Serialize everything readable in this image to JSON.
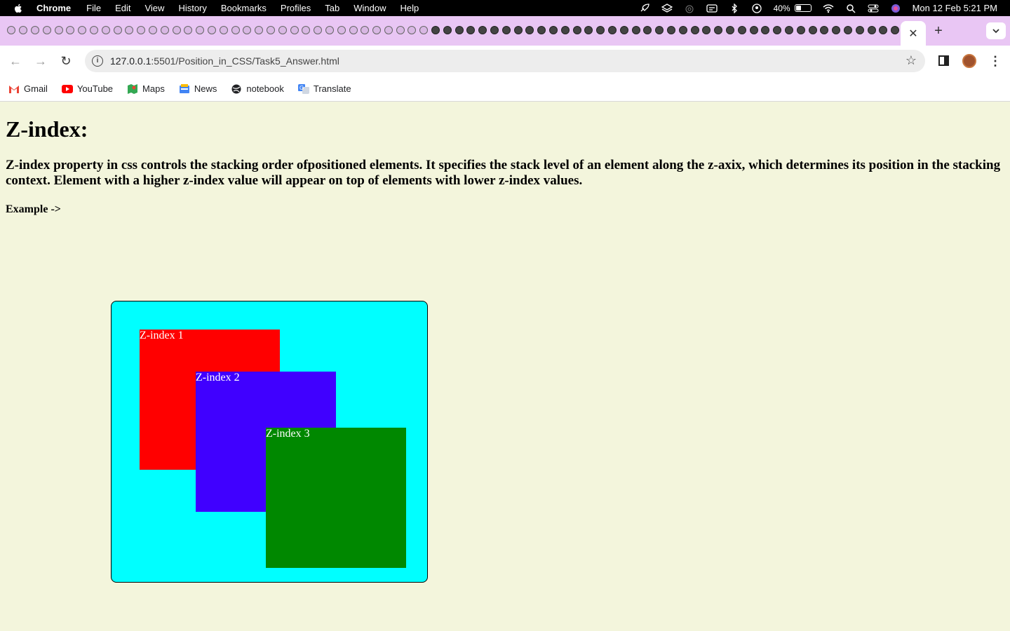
{
  "menubar": {
    "app_name": "Chrome",
    "menus": [
      "File",
      "Edit",
      "View",
      "History",
      "Bookmarks",
      "Profiles",
      "Tab",
      "Window",
      "Help"
    ],
    "battery_percent": "40%",
    "battery_level": 0.4,
    "datetime": "Mon 12 Feb  5:21 PM"
  },
  "tabs": {
    "favicon_count": 76,
    "close_glyph": "✕",
    "new_tab_glyph": "+",
    "tab_list_glyph": "⌄"
  },
  "toolbar": {
    "back_glyph": "←",
    "forward_glyph": "→",
    "reload_glyph": "↻",
    "url_host": "127.0.0.1",
    "url_path": ":5501/Position_in_CSS/Task5_Answer.html",
    "star_glyph": "☆",
    "menu_glyph": "⋮"
  },
  "bookmarks": [
    {
      "label": "Gmail",
      "color": "#ea4335"
    },
    {
      "label": "YouTube",
      "color": "#ff0000"
    },
    {
      "label": "Maps",
      "color": "#34a853"
    },
    {
      "label": "News",
      "color": "#4285f4"
    },
    {
      "label": "notebook",
      "color": "#202124"
    },
    {
      "label": "Translate",
      "color": "#4285f4"
    }
  ],
  "page": {
    "title": "Z-index:",
    "description": "Z-index property in css controls the stacking order ofpositioned elements. It specifies the stack level of an element along the z-axix, which determines its position in the stacking context. Element with a higher z-index value will appear on top of elements with lower z-index values.",
    "example_label": "Example ->",
    "boxes": [
      {
        "label": "Z-index 1",
        "color": "#ff0000"
      },
      {
        "label": "Z-index 2",
        "color": "#4000ff"
      },
      {
        "label": "Z-index 3",
        "color": "#008800"
      }
    ],
    "container_color": "#00ffff",
    "background_color": "#f3f5dc"
  }
}
